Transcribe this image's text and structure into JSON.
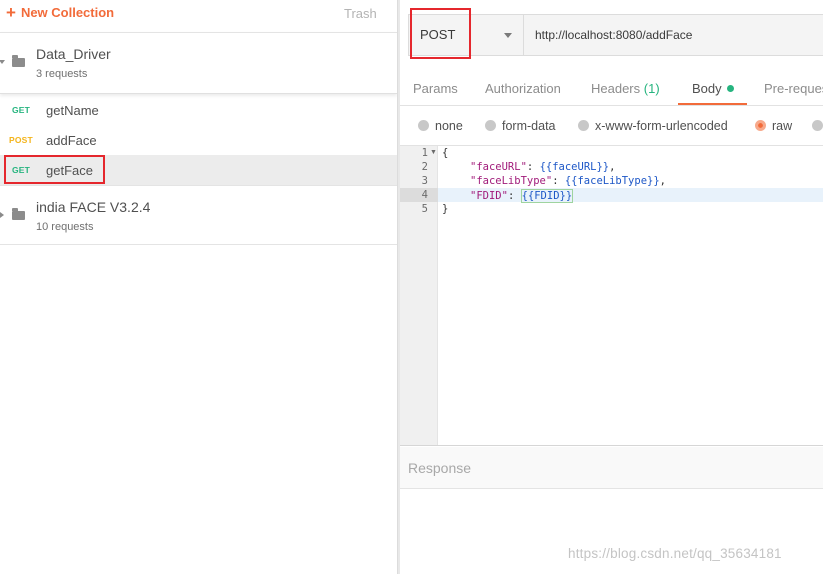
{
  "sidebar": {
    "new_collection_label": "New Collection",
    "trash_label": "Trash",
    "collections": [
      {
        "name": "Data_Driver",
        "count": "3 requests"
      },
      {
        "name": "india FACE V3.2.4",
        "count": "10 requests"
      }
    ],
    "requests": [
      {
        "method": "GET",
        "name": "getName",
        "method_color": "#26b47f"
      },
      {
        "method": "POST",
        "name": "addFace",
        "method_color": "#f4b41a"
      },
      {
        "method": "GET",
        "name": "getFace",
        "method_color": "#26b47f"
      }
    ]
  },
  "request": {
    "method": "POST",
    "url": "http://localhost:8080/addFace"
  },
  "tabs": {
    "params": "Params",
    "authorization": "Authorization",
    "headers": "Headers",
    "headers_count": "(1)",
    "body": "Body",
    "pre_request": "Pre-reques"
  },
  "body_modes": {
    "none": "none",
    "form_data": "form-data",
    "urlencoded": "x-www-form-urlencoded",
    "raw": "raw",
    "selected": "raw"
  },
  "editor": {
    "line_numbers": [
      "1",
      "2",
      "3",
      "4",
      "5"
    ],
    "lines": [
      {
        "open": "{"
      },
      {
        "key": "\"faceURL\"",
        "sep": ": ",
        "value": "{{faceURL}}",
        "end": ","
      },
      {
        "key": "\"faceLibType\"",
        "sep": ": ",
        "value": "{{faceLibType}}",
        "end": ","
      },
      {
        "key": "\"FDID\"",
        "sep": ": ",
        "value": "{{FDID}}",
        "end": ""
      },
      {
        "close": "}"
      }
    ]
  },
  "response": {
    "label": "Response"
  },
  "watermark": "https://blog.csdn.net/qq_35634181",
  "colors": {
    "accent": "#f26b3a",
    "get": "#26b47f",
    "post": "#f4b41a",
    "highlight_box": "#e5272d"
  }
}
